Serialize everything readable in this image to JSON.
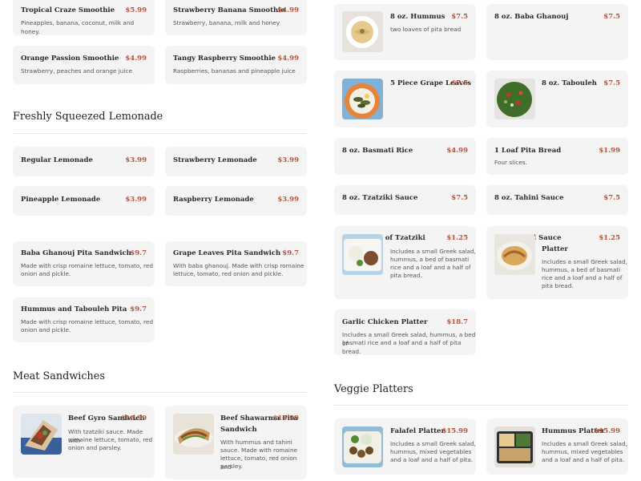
{
  "colors": {
    "card_bg": "#f4f4f4",
    "price": "#b5523a",
    "text": "#2a2a2a",
    "muted": "#555555"
  },
  "left": {
    "smoothies": [
      {
        "name": "Tropical Craze Smoothie",
        "price": "$5.99",
        "desc": "Pineapples, banana, coconut, milk and honey."
      },
      {
        "name": "Strawberry Banana Smoothie",
        "price": "$4.99",
        "desc": "Strawberry, banana, milk and honey"
      },
      {
        "name": "Orange Passion Smoothie",
        "price": "$4.99",
        "desc": "Strawberry, peaches and orange juice"
      },
      {
        "name": "Tangy Raspberry Smoothie",
        "price": "$4.99",
        "desc": "Raspberries, bananas and pineapple juice"
      }
    ],
    "lemonade_title": "Freshly Squeezed Lemonade",
    "lemonades": [
      {
        "name": "Regular Lemonade",
        "price": "$3.99"
      },
      {
        "name": "Strawberry Lemonade",
        "price": "$3.99"
      },
      {
        "name": "Pineapple Lemonade",
        "price": "$3.99"
      },
      {
        "name": "Raspberry Lemonade",
        "price": "$3.99"
      }
    ],
    "veg_sandwiches": [
      {
        "name": "Baba Ghanouj Pita Sandwich",
        "price": "$9.7",
        "desc_lines": [
          "Made with crisp romaine lettuce, tomato, red",
          "onion and pickle."
        ]
      },
      {
        "name": "Grape Leaves Pita Sandwich",
        "price": "$9.7",
        "desc_lines": [
          "With baba ghanouj. Made with crisp romaine",
          "lettuce, tomato, red onion and pickle."
        ]
      },
      {
        "name": "Hummus and Tabouleh Pita",
        "price": "$9.7",
        "desc_lines": [
          "Made with crisp romaine lettuce, tomato, red",
          "onion and pickle."
        ]
      }
    ],
    "meat_title": "Meat Sandwiches",
    "meat_sandwiches": [
      {
        "name": "Beef Gyro Sandwich",
        "price": "$10.99",
        "desc_lines": [
          "With tzatziki sauce. Made with",
          "romaine lettuce, tomato, red",
          "onion and parsley."
        ]
      },
      {
        "name_lines": [
          "Beef Shawarma Pita",
          "Sandwich"
        ],
        "price": "$10.99",
        "desc_lines": [
          "With hummus and tahini",
          "sauce. Made with romaine",
          "lettuce, tomato, red onion and",
          "parsley."
        ]
      }
    ]
  },
  "right": {
    "sides": [
      {
        "name": "8 oz. Hummus",
        "price": "$7.5",
        "desc": "two loaves of pita bread"
      },
      {
        "name": "8 oz. Baba Ghanouj",
        "price": "$7.5"
      },
      {
        "name": "5 Piece Grape Leaves",
        "price": "$7.5"
      },
      {
        "name": "8 oz. Tabouleh",
        "price": "$7.5"
      },
      {
        "name": "8 oz. Basmati Rice",
        "price": "$4.99"
      },
      {
        "name": "1 Loaf Pita Bread",
        "price": "$1.99",
        "desc": "Four slices."
      },
      {
        "name": "8 oz. Tzatziki Sauce",
        "price": "$7.5"
      },
      {
        "name": "8 oz. Tahini Sauce",
        "price": "$7.5"
      },
      {
        "name": "Small Side of Tzatziki",
        "price": "$1.25"
      },
      {
        "name": "2 oz Tahini Sauce",
        "price": "$1.25"
      }
    ],
    "platters": [
      {
        "desc_lines": [
          "Includes a small Greek salad,",
          "hummus, a bed of basmati",
          "rice and a loaf and a half of",
          "pita bread."
        ]
      },
      {
        "name": "Platter",
        "desc_lines": [
          "Includes a small Greek salad,",
          "hummus, a bed of basmati",
          "rice and a loaf and a half of",
          "pita bread."
        ]
      },
      {
        "name": "Garlic Chicken Platter",
        "price": "$18.7",
        "desc_lines": [
          "Includes a small Greek salad, hummus, a bed of",
          "basmati rice and a loaf and a half of pita bread."
        ]
      }
    ],
    "veggie_title": "Veggie Platters",
    "veggie_platters": [
      {
        "name": "Falafel Platter",
        "price": "$15.99",
        "desc_lines": [
          "Includes a small Greek salad,",
          "hummus, mixed vegetables",
          "and a loaf and a half of pita."
        ]
      },
      {
        "name": "Hummus Platter",
        "price": "$15.99",
        "desc_lines": [
          "Includes a small Greek salad,",
          "hummus, mixed vegetables",
          "and a loaf and a half of pita."
        ]
      }
    ]
  }
}
